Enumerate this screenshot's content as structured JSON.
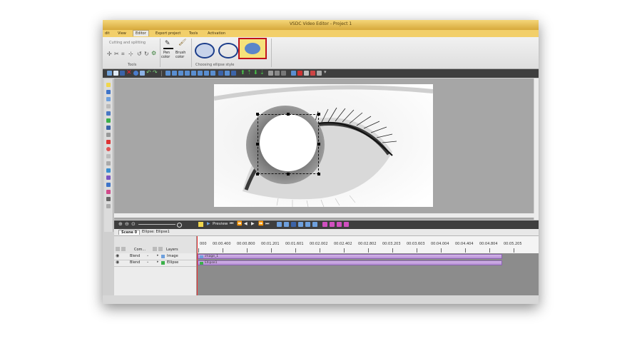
{
  "window": {
    "title": "VSDC Video Editor - Project 1"
  },
  "menu": [
    {
      "label": "dit",
      "active": false
    },
    {
      "label": "View",
      "active": false
    },
    {
      "label": "Editor",
      "active": true
    },
    {
      "label": "Export project",
      "active": false
    },
    {
      "label": "Tools",
      "active": false
    },
    {
      "label": "Activation",
      "active": false
    }
  ],
  "ribbon": {
    "cutting": "Cutting and splitting",
    "tools_label": "Tools",
    "pen_label": "Pen",
    "pen_sub": "color",
    "brush_label": "Brush",
    "brush_sub": "color",
    "ellipse_style_label": "Choosing ellipse style"
  },
  "colors": {
    "ellipse_fill": "#5b86c9",
    "highlight_box": "#c0121d",
    "selected_bg": "#f6e27a"
  },
  "timeline": {
    "tabs": [
      "Scene 0",
      "Ellipse: Ellipse1"
    ],
    "preview_label": "Preview",
    "com_label": "Com...",
    "layers_label": "Layers",
    "ticks": [
      "000",
      "00:00.400",
      "00:00.800",
      "00:01.201",
      "00:01.601",
      "00:02.002",
      "00:02.402",
      "00:02.802",
      "00:03.203",
      "00:03.603",
      "00:04.004",
      "00:04.404",
      "00:04.804",
      "00:05.205"
    ],
    "layers": [
      {
        "blend": "Blend",
        "name": "Image",
        "clip": "image_1"
      },
      {
        "blend": "Blend",
        "name": "Ellipse",
        "clip": "Ellipse1"
      }
    ]
  }
}
